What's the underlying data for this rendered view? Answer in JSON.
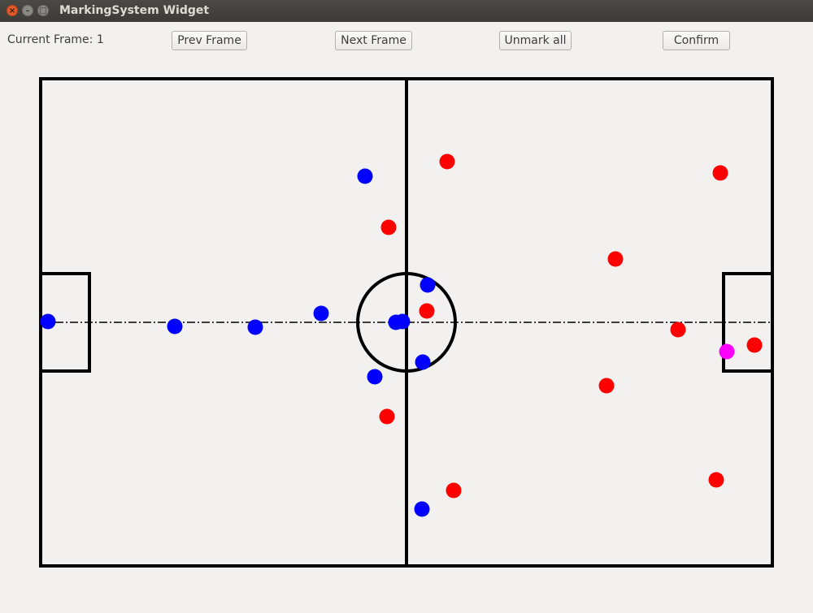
{
  "window": {
    "title": "MarkingSystem Widget"
  },
  "toolbar": {
    "frame_label": "Current Frame: 1",
    "prev_label": "Prev Frame",
    "next_label": "Next Frame",
    "unmark_label": "Unmark all",
    "confirm_label": "Confirm"
  },
  "colors": {
    "team_blue": "#0000ff",
    "team_red": "#ff0000",
    "ball": "#ff00ff",
    "field_lines": "#000000",
    "background": "#f2f1f0"
  }
}
